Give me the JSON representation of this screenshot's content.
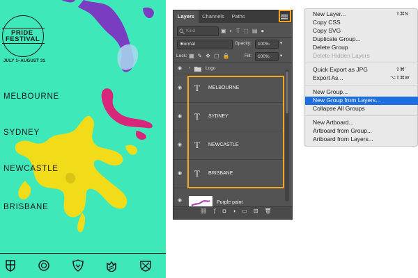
{
  "poster": {
    "logo_top": "PRIDE",
    "logo_bottom": "FESTIVAL",
    "dates": "JULY 1–AUGUST 31",
    "cities": [
      "MELBOURNE",
      "SYDNEY",
      "NEWCASTLE",
      "BRISBANE"
    ],
    "footer_icons": [
      "crest-icon",
      "globe-icon",
      "shield-icon",
      "crown-shield-icon",
      "crossed-shield-icon"
    ],
    "colors": {
      "background": "#3fe8b8",
      "purple": "#7a3cc0",
      "magenta": "#d8267a",
      "yellow": "#f2dc1a"
    }
  },
  "layers_panel": {
    "tabs": [
      "Layers",
      "Channels",
      "Paths"
    ],
    "active_tab": "Layers",
    "kind_placeholder": "Kind",
    "blend_mode": "Normal",
    "opacity_label": "Opacity:",
    "opacity_value": "100%",
    "lock_label": "Lock:",
    "fill_label": "Fill:",
    "fill_value": "100%",
    "group_name": "Logo",
    "text_layers": [
      "MELBOURNE",
      "SYDNEY",
      "NEWCASTLE",
      "BRISBANE"
    ],
    "paint_layer": "Purple paint",
    "highlight_color": "#f5a623"
  },
  "context_menu": {
    "items": [
      {
        "label": "New Layer...",
        "shortcut": "⇧⌘N"
      },
      {
        "label": "Copy CSS"
      },
      {
        "label": "Copy SVG"
      },
      {
        "label": "Duplicate Group..."
      },
      {
        "label": "Delete Group"
      },
      {
        "label": "Delete Hidden Layers",
        "disabled": true
      },
      {
        "label": "Quick Export as JPG",
        "shortcut": "⇧⌘'"
      },
      {
        "label": "Export As...",
        "shortcut": "⌥⇧⌘W"
      },
      {
        "label": "New Group..."
      },
      {
        "label": "New Group from Layers...",
        "selected": true
      },
      {
        "label": "Collapse All Groups"
      },
      {
        "label": "New Artboard..."
      },
      {
        "label": "Artboard from Group..."
      },
      {
        "label": "Artboard from Layers..."
      }
    ],
    "selected_color": "#1d6fe0"
  }
}
